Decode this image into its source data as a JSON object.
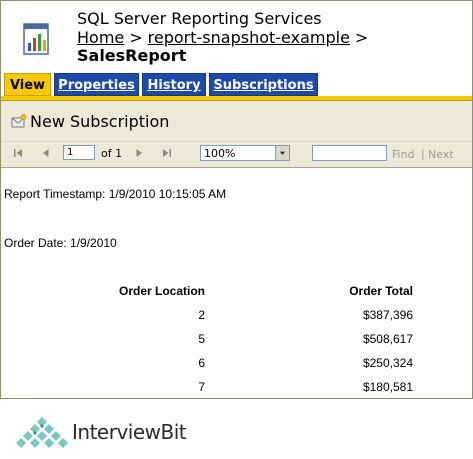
{
  "header": {
    "app_title": "SQL Server Reporting Services",
    "breadcrumb": [
      {
        "label": "Home"
      },
      {
        "label": "report-snapshot-example"
      }
    ],
    "breadcrumb_separator": ">",
    "report_name": "SalesReport"
  },
  "tabs": [
    {
      "label": "View",
      "active": true
    },
    {
      "label": "Properties",
      "active": false
    },
    {
      "label": "History",
      "active": false
    },
    {
      "label": "Subscriptions",
      "active": false
    }
  ],
  "actions": {
    "new_subscription": "New Subscription"
  },
  "toolbar": {
    "page_value": "1",
    "page_of": "of 1",
    "zoom": "100%",
    "find_value": "",
    "find_label": "Find",
    "separator": "|",
    "next_label": "Next"
  },
  "report": {
    "timestamp": "Report Timestamp: 1/9/2010 10:15:05 AM",
    "order_date": "Order Date: 1/9/2010",
    "columns": [
      "Order Location",
      "Order Total"
    ],
    "rows": [
      {
        "location": "2",
        "total": "$387,396"
      },
      {
        "location": "5",
        "total": "$508,617"
      },
      {
        "location": "6",
        "total": "$250,324"
      },
      {
        "location": "7",
        "total": "$180,581"
      }
    ]
  },
  "watermark": {
    "brand": "InterviewBit"
  },
  "colors": {
    "tab_active": "#f6c800",
    "tab_inactive": "#1f4ba8",
    "toolbar_bg": "#ece9d8"
  }
}
